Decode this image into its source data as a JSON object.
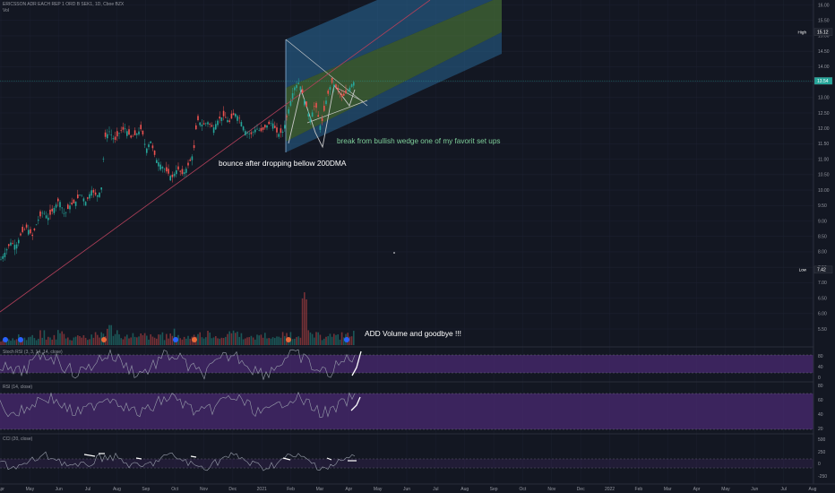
{
  "header": {
    "symbol_line": "ERICSSON ADR EACH REP 1 ORD B SEK1, 1D, Cboe BZX",
    "sub_line": "Vol"
  },
  "chart_data": {
    "type": "candlestick",
    "price_axis": {
      "ticks": [
        "16.00",
        "15.50",
        "15.00",
        "14.50",
        "14.00",
        "13.50",
        "13.00",
        "12.50",
        "12.00",
        "11.50",
        "11.00",
        "10.50",
        "10.00",
        "9.50",
        "9.00",
        "8.50",
        "8.00",
        "7.50",
        "7.00",
        "6.50",
        "6.00",
        "5.50"
      ],
      "ylim": [
        5.4,
        16.1
      ]
    },
    "price_markers": [
      {
        "label": "High",
        "value": "15.12",
        "price": 15.12
      },
      {
        "label": "",
        "value": "13.54",
        "price": 13.54
      },
      {
        "label": "Low",
        "value": "7.42",
        "price": 7.42
      }
    ],
    "time_axis": {
      "ticks": [
        "Apr",
        "May",
        "Jun",
        "Jul",
        "Aug",
        "Sep",
        "Oct",
        "Nov",
        "Dec",
        "2021",
        "Feb",
        "Mar",
        "Apr",
        "May",
        "Jun",
        "Jul",
        "Aug",
        "Sep",
        "Oct",
        "Nov",
        "Dec",
        "2022",
        "Feb",
        "Mar",
        "Apr",
        "May",
        "Jun",
        "Jul",
        "Aug"
      ]
    },
    "annotations": [
      {
        "text": "break from bullish wedge one of my favorit set ups",
        "color": "#7fcf9a"
      },
      {
        "text": "bounce after dropping bellow 200DMA",
        "color": "#ffffff"
      },
      {
        "text": "ADD Volume and goodbye !!!",
        "color": "#ffffff"
      }
    ],
    "price_path": [
      [
        0,
        7.7
      ],
      [
        6,
        8.0
      ],
      [
        12,
        8.3
      ],
      [
        18,
        8.2
      ],
      [
        24,
        8.6
      ],
      [
        30,
        8.8
      ],
      [
        36,
        8.5
      ],
      [
        42,
        9.0
      ],
      [
        48,
        9.3
      ],
      [
        54,
        9.1
      ],
      [
        60,
        9.4
      ],
      [
        66,
        9.7
      ],
      [
        72,
        9.2
      ],
      [
        78,
        9.5
      ],
      [
        84,
        9.6
      ],
      [
        90,
        9.9
      ],
      [
        96,
        9.6
      ],
      [
        102,
        10.0
      ],
      [
        108,
        9.8
      ],
      [
        113,
        10.0
      ],
      [
        117,
        11.7
      ],
      [
        122,
        11.9
      ],
      [
        128,
        11.6
      ],
      [
        134,
        11.9
      ],
      [
        140,
        12.0
      ],
      [
        146,
        11.7
      ],
      [
        152,
        11.8
      ],
      [
        158,
        12.0
      ],
      [
        163,
        11.3
      ],
      [
        168,
        11.6
      ],
      [
        174,
        11.0
      ],
      [
        180,
        10.8
      ],
      [
        186,
        10.6
      ],
      [
        192,
        10.4
      ],
      [
        198,
        10.7
      ],
      [
        204,
        10.5
      ],
      [
        210,
        10.8
      ],
      [
        216,
        11.2
      ],
      [
        220,
        12.3
      ],
      [
        226,
        12.1
      ],
      [
        232,
        12.2
      ],
      [
        238,
        12.0
      ],
      [
        244,
        12.3
      ],
      [
        250,
        12.4
      ],
      [
        256,
        12.2
      ],
      [
        262,
        12.5
      ],
      [
        268,
        12.3
      ],
      [
        274,
        11.9
      ],
      [
        280,
        11.8
      ],
      [
        286,
        12.0
      ],
      [
        292,
        11.9
      ],
      [
        298,
        12.1
      ],
      [
        304,
        12.2
      ],
      [
        310,
        11.8
      ],
      [
        316,
        11.9
      ],
      [
        322,
        12.6
      ],
      [
        328,
        13.3
      ],
      [
        334,
        13.5
      ],
      [
        340,
        12.9
      ],
      [
        346,
        12.3
      ],
      [
        352,
        12.8
      ],
      [
        358,
        12.0
      ],
      [
        364,
        12.9
      ],
      [
        370,
        13.5
      ],
      [
        376,
        13.3
      ],
      [
        382,
        13.0
      ],
      [
        388,
        13.2
      ],
      [
        394,
        13.5
      ]
    ],
    "volume_path": [
      3,
      5,
      4,
      6,
      5,
      7,
      4,
      8,
      5,
      6,
      9,
      7,
      5,
      6,
      8,
      5,
      7,
      6,
      9,
      12,
      10,
      7,
      6,
      8,
      5,
      7,
      6,
      5,
      8,
      6,
      7,
      9,
      5,
      6,
      7,
      10,
      6,
      8,
      5,
      7,
      6,
      11,
      9,
      7,
      5,
      6,
      8,
      7,
      6,
      5,
      7,
      8,
      6,
      9,
      30,
      8,
      7,
      6,
      9,
      7,
      6,
      8,
      7,
      10
    ],
    "indicators": [
      {
        "name": "Stoch RSI (3, 3, 14, 14, close)",
        "ticks": [
          "80",
          "40",
          "0"
        ]
      },
      {
        "name": "RSI (14, close)",
        "ticks": [
          "80",
          "60",
          "40",
          "20"
        ]
      },
      {
        "name": "CCI (20, close)",
        "ticks": [
          "500",
          "250",
          "0",
          "-250"
        ]
      }
    ]
  },
  "colors": {
    "background": "#131722",
    "up": "#26a69a",
    "down": "#ef5350",
    "indicator_band": "#4a2a72",
    "channel_blue": "#2a6b9c",
    "channel_green": "#4f7d3a"
  }
}
